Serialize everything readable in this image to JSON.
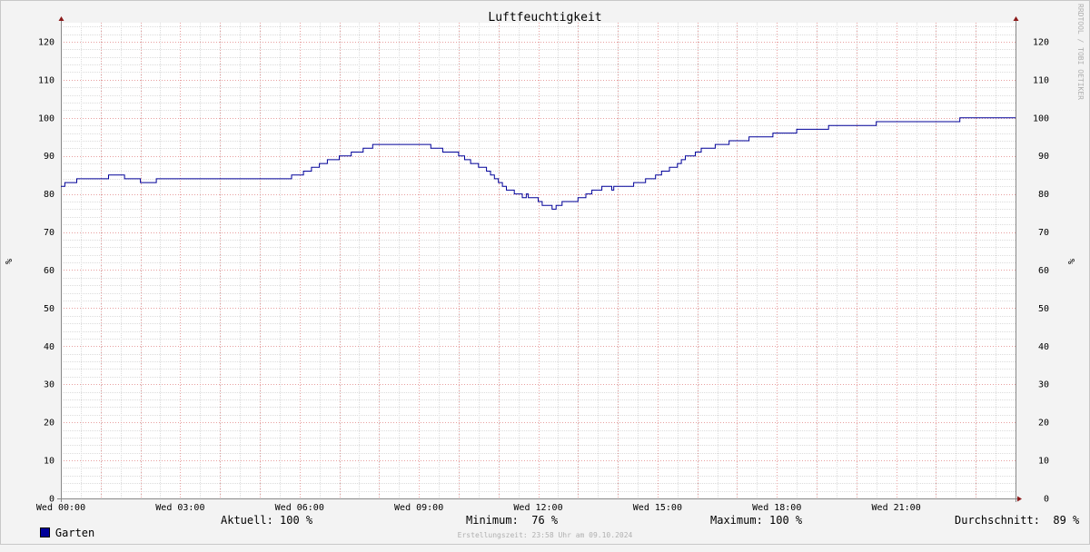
{
  "chart_data": {
    "type": "line",
    "title": "Luftfeuchtigkeit",
    "ylabel": "%",
    "ylim": [
      0,
      125
    ],
    "y_ticks": [
      0,
      10,
      20,
      30,
      40,
      50,
      60,
      70,
      80,
      90,
      100,
      110,
      120
    ],
    "xlim_hours": [
      0,
      24
    ],
    "x_ticks": [
      {
        "hour": 0,
        "label": "Wed 00:00"
      },
      {
        "hour": 3,
        "label": "Wed 03:00"
      },
      {
        "hour": 6,
        "label": "Wed 06:00"
      },
      {
        "hour": 9,
        "label": "Wed 09:00"
      },
      {
        "hour": 12,
        "label": "Wed 12:00"
      },
      {
        "hour": 15,
        "label": "Wed 15:00"
      },
      {
        "hour": 18,
        "label": "Wed 18:00"
      },
      {
        "hour": 21,
        "label": "Wed 21:00"
      }
    ],
    "grid": true,
    "legend_position": "bottom",
    "series": [
      {
        "name": "Garten",
        "color": "#000099",
        "x_hours": [
          0,
          0.1,
          0.4,
          1.2,
          1.6,
          2.0,
          2.4,
          2.8,
          3.6,
          4.6,
          5.5,
          5.8,
          6.1,
          6.3,
          6.5,
          6.7,
          7.0,
          7.3,
          7.6,
          7.8,
          7.84,
          7.9,
          8.5,
          9.3,
          9.6,
          10.0,
          10.15,
          10.3,
          10.5,
          10.7,
          10.8,
          10.9,
          11.0,
          11.1,
          11.2,
          11.4,
          11.6,
          11.7,
          11.75,
          11.8,
          12.0,
          12.1,
          12.35,
          12.45,
          12.5,
          12.6,
          12.7,
          13.0,
          13.2,
          13.35,
          13.6,
          13.8,
          13.85,
          13.9,
          14.0,
          14.4,
          14.7,
          14.95,
          15.1,
          15.3,
          15.5,
          15.6,
          15.7,
          15.85,
          15.95,
          16.1,
          16.45,
          16.8,
          17.3,
          17.9,
          18.5,
          19.3,
          20.5,
          21.9,
          22.6,
          24.0
        ],
        "values": [
          82,
          83,
          84,
          85,
          84,
          83,
          84,
          84,
          84,
          84,
          84,
          85,
          86,
          87,
          88,
          89,
          90,
          91,
          92,
          92,
          93,
          93,
          93,
          92,
          91,
          90,
          89,
          88,
          87,
          86,
          85,
          84,
          83,
          82,
          81,
          80,
          79,
          80,
          79,
          79,
          78,
          77,
          76,
          77,
          77,
          78,
          78,
          79,
          80,
          81,
          82,
          82,
          81,
          82,
          82,
          83,
          84,
          85,
          86,
          87,
          88,
          89,
          90,
          90,
          91,
          92,
          93,
          94,
          95,
          96,
          97,
          98,
          99,
          99,
          100,
          100
        ]
      }
    ]
  },
  "legend": {
    "series_name": "Garten",
    "aktuell": "Aktuell: 100 %",
    "minimum": "Minimum:  76 %",
    "maximum": "Maximum: 100 %",
    "durchschnitt": "Durchschnitt:  89 %"
  },
  "watermark": "RRDTOOL / TOBI OETIKER",
  "footer": "Erstellungszeit: 23:58 Uhr am 09.10.2024"
}
